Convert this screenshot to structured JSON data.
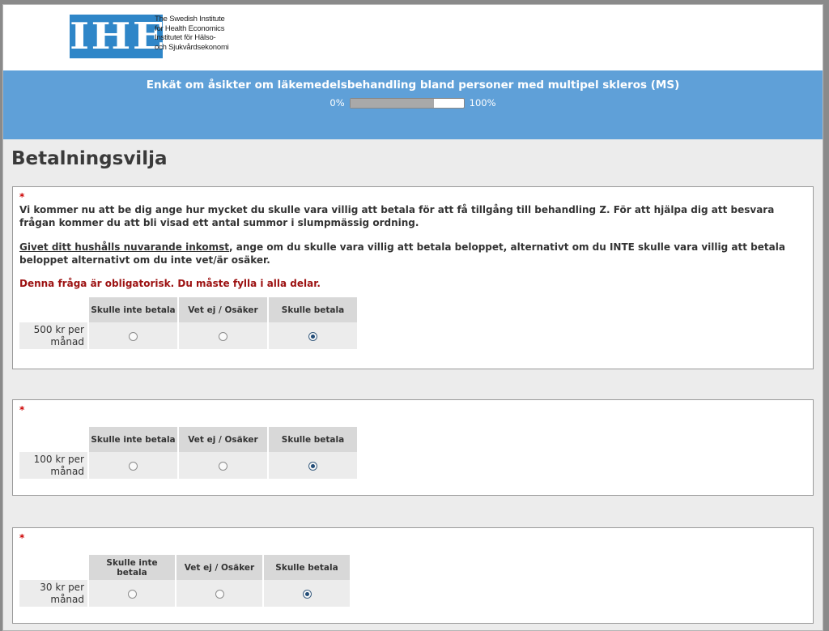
{
  "logo": {
    "mark": "IHE",
    "lines": [
      "The Swedish Institute",
      "for Health Economics",
      "Institutet för Hälso-",
      "och Sjukvårdsekonomi"
    ]
  },
  "header": {
    "title": "Enkät om åsikter om läkemedelsbehandling bland personer med multipel skleros (MS)",
    "progress_min": "0%",
    "progress_max": "100%",
    "progress_fraction": 0.74
  },
  "section": {
    "title": "Betalningsvilja"
  },
  "columns": [
    "Skulle inte betala",
    "Vet ej / Osäker",
    "Skulle betala"
  ],
  "questions": [
    {
      "required_mark": "*",
      "intro": "Vi kommer nu att be dig ange hur mycket du skulle vara villig att betala för att få tillgång till behandling Z. För att hjälpa dig att besvara frågan kommer du att bli visad ett antal summor i slumpmässig ordning.",
      "instruction_underlined": "Givet ditt hushålls nuvarande inkomst",
      "instruction_rest": ", ange om du skulle vara villig att betala beloppet, alternativt om du INTE skulle vara villig att betala beloppet alternativt om du inte vet/är osäker.",
      "mandatory": "Denna fråga är obligatorisk. Du måste fylla i alla delar.",
      "row_label": "500 kr per månad",
      "selected": 2
    },
    {
      "required_mark": "*",
      "row_label": "100 kr per månad",
      "selected": 2
    },
    {
      "required_mark": "*",
      "row_label": "30 kr per månad",
      "selected": 2
    }
  ]
}
